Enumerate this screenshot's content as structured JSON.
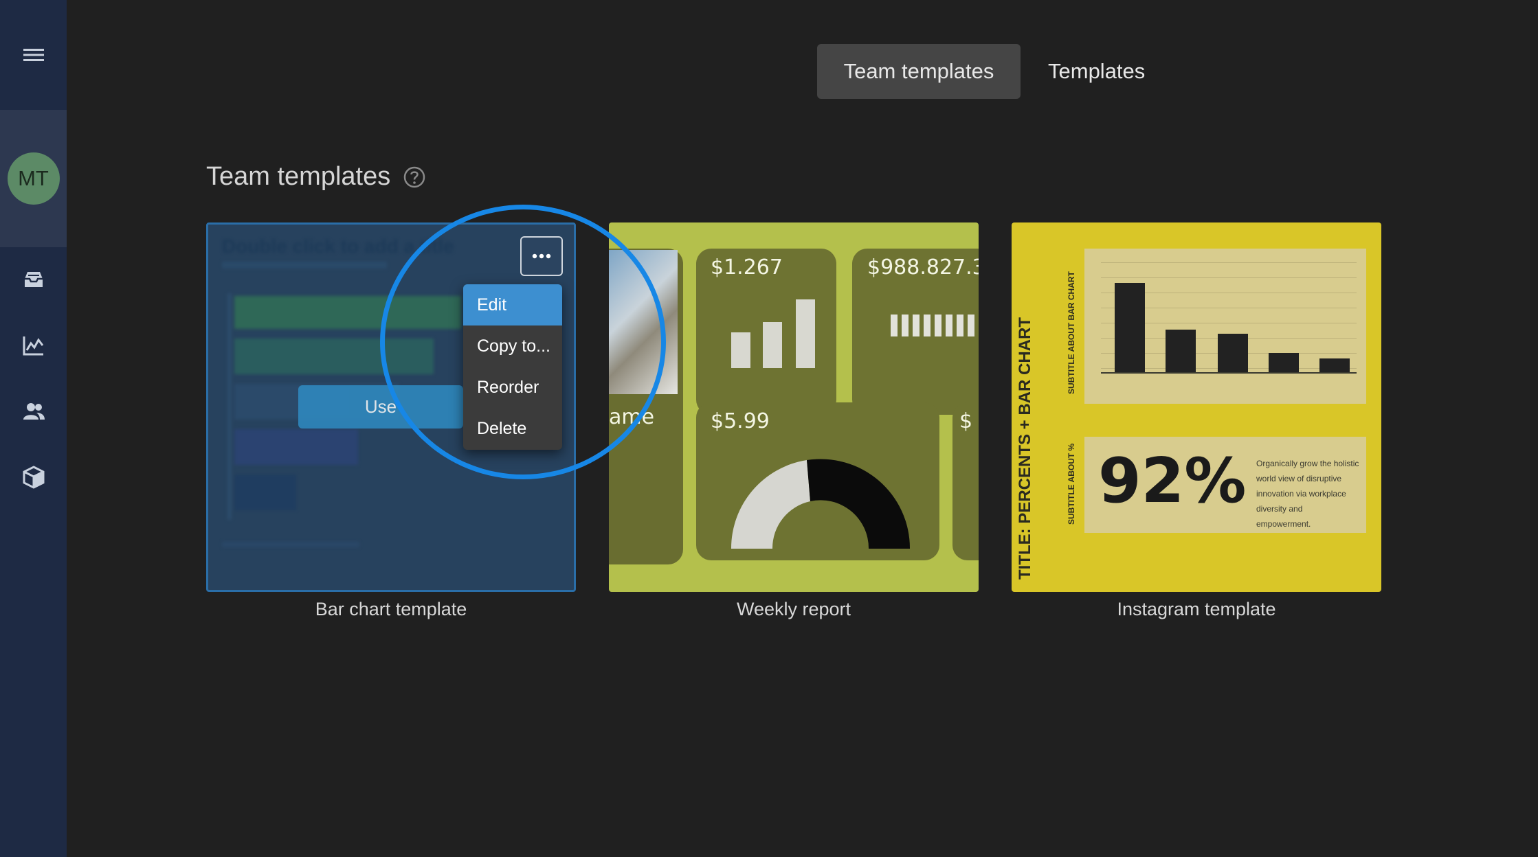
{
  "sidebar": {
    "menu_icon": "hamburger-menu-icon",
    "avatar_initials": "MT",
    "items": [
      {
        "icon": "inbox-tray-icon"
      },
      {
        "icon": "line-chart-icon"
      },
      {
        "icon": "users-icon"
      },
      {
        "icon": "cube-icon"
      }
    ]
  },
  "tabs": [
    {
      "label": "Team templates",
      "active": true
    },
    {
      "label": "Templates",
      "active": false
    }
  ],
  "section": {
    "title": "Team templates",
    "help_icon": "question-circle-icon"
  },
  "cards": [
    {
      "label": "Bar chart template",
      "preview_title": "Double click to add a title",
      "use_button": "Use",
      "more_icon": "more-dots-icon"
    },
    {
      "label": "Weekly report",
      "preview_values": [
        "$1.267",
        "$988.827.3!",
        "$5.99",
        "ame",
        "$"
      ]
    },
    {
      "label": "Instagram template",
      "preview_title": "TITLE: PERCENTS + BAR CHART",
      "preview_subtitle": "SUBTITLE ABOUT %",
      "preview_chart_subtitle": "SUBTITLE ABOUT BAR CHART",
      "preview_percent": "92%",
      "preview_text": "Organically grow the holistic world view of disruptive innovation via workplace diversity and empowerment."
    }
  ],
  "context_menu": {
    "items": [
      "Edit",
      "Copy to...",
      "Reorder",
      "Delete"
    ],
    "highlighted": "Edit"
  },
  "colors": {
    "sidebar": "#1e2a44",
    "background": "#202020",
    "accent": "#1787e6",
    "menu_highlight": "#3d8fd0"
  }
}
